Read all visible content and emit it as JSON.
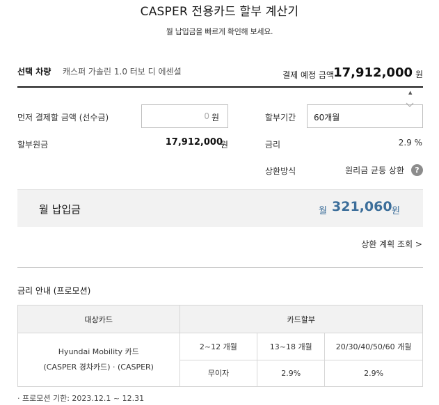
{
  "header": {
    "title": "CASPER 전용카드 할부 계산기",
    "subtitle": "월 납입금을 빠르게 확인해 보세요."
  },
  "vehicle": {
    "label": "선택 차량",
    "name": "캐스퍼 가솔린 1.0 터보 디 에센셜",
    "price_label": "결제 예정 금액",
    "price_value": "17,912,000",
    "price_unit": "원"
  },
  "form": {
    "down_payment_label": "먼저 결제할 금액 (선수금)",
    "down_payment_value": "0",
    "down_payment_unit": "원",
    "period_label": "할부기간",
    "period_value": "60개월",
    "principal_label": "할부원금",
    "principal_value": "17,912,000",
    "principal_unit": "원",
    "rate_label": "금리",
    "rate_value": "2.9 %",
    "method_label": "상환방식",
    "method_value": "원리금 균등 상환",
    "help_glyph": "?"
  },
  "result": {
    "label": "월 납입금",
    "pre_unit": "월",
    "amount": "321,060",
    "unit": "원",
    "accent_color": "#3c6e9a"
  },
  "schedule_link": "상환 계획 조회 >",
  "promotion": {
    "title": "금리 안내 (프로모션)",
    "headers": {
      "card": "대상카드",
      "installment": "카드할부"
    },
    "card_lines": [
      "Hyundai Mobility 카드",
      "(CASPER 경차카드) · (CASPER)"
    ],
    "periods": [
      "2~12 개월",
      "13~18 개월",
      "20/30/40/50/60 개월"
    ],
    "rates": [
      "무이자",
      "2.9%",
      "2.9%"
    ],
    "footnote": "· 프로모션 기한: 2023.12.1 ~ 12.31"
  }
}
